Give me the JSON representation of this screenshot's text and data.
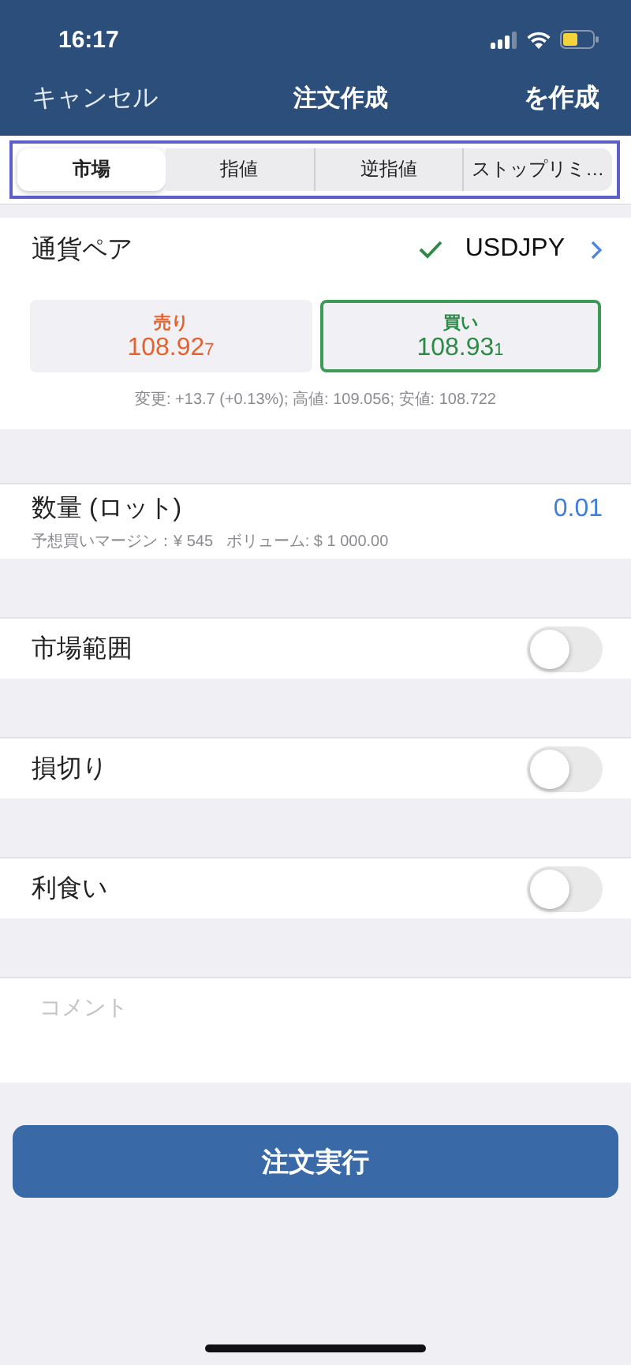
{
  "status_bar": {
    "time": "16:17"
  },
  "nav": {
    "left": "キャンセル",
    "title": "注文作成",
    "right": "を作成"
  },
  "tabs": [
    {
      "label": "市場",
      "selected": true
    },
    {
      "label": "指値",
      "selected": false
    },
    {
      "label": "逆指値",
      "selected": false
    },
    {
      "label": "ストップリミ…",
      "selected": false
    }
  ],
  "pair": {
    "label": "通貨ペア",
    "value": "USDJPY",
    "valid": true
  },
  "quotes": [
    {
      "kind": "sell",
      "label": "売り",
      "price": "108.92$_{7}$",
      "selected": false
    },
    {
      "kind": "buy",
      "label": "買い",
      "price": "108.93$_{1}$",
      "selected": true
    }
  ],
  "stats": "変更: +13.7 (+0.13%); 高値: 109.056; 安値: 108.722",
  "volume": {
    "label": "数量 (ロット)",
    "value": "0.01",
    "note": "予想買いマージン：¥ 545   ボリューム: $ 1 000.00"
  },
  "switches": [
    {
      "label": "市場範囲",
      "on": false
    },
    {
      "label": "損切り",
      "on": false
    },
    {
      "label": "利食い",
      "on": false
    }
  ],
  "comment": {
    "placeholder": "コメント"
  },
  "submit": "注文実行"
}
